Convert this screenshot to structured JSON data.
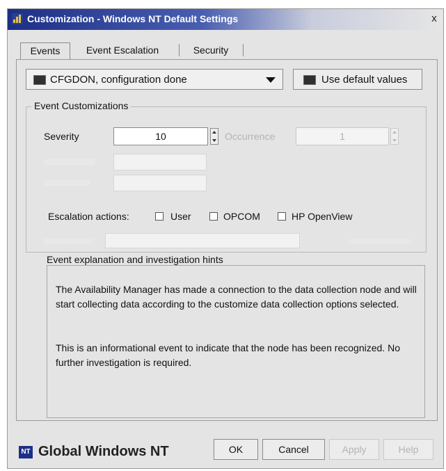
{
  "window": {
    "title": "Customization - Windows NT Default Settings",
    "close_glyph": "x"
  },
  "tabs": [
    {
      "label": "Events",
      "active": true
    },
    {
      "label": "Event Escalation",
      "active": false
    },
    {
      "label": "Security",
      "active": false
    }
  ],
  "event_select": {
    "value": "CFGDON, configuration done",
    "icon": "event-monitor-icon"
  },
  "use_default_button": {
    "label": "Use default values",
    "icon": "monitor-icon"
  },
  "customizations": {
    "title": "Event Customizations",
    "severity_label": "Severity",
    "severity_value": "10",
    "occurrence_label": "Occurrence",
    "occurrence_value": "1"
  },
  "escalation": {
    "label": "Escalation actions:",
    "options": [
      {
        "label": "User",
        "checked": false
      },
      {
        "label": "OPCOM",
        "checked": false
      },
      {
        "label": "HP OpenView",
        "checked": false
      }
    ]
  },
  "hints": {
    "title": "Event explanation and investigation hints",
    "para1": "The Availability Manager has made a connection to the data collection node and will start collecting data according to the customize data collection options selected.",
    "para2": "This is an informational event to indicate that the node has been recognized. No further investigation is required."
  },
  "footer": {
    "brand_logo_text": "NT",
    "brand_label": "Global Windows NT",
    "ok_label": "OK",
    "cancel_label": "Cancel",
    "apply_label": "Apply",
    "help_label": "Help"
  }
}
